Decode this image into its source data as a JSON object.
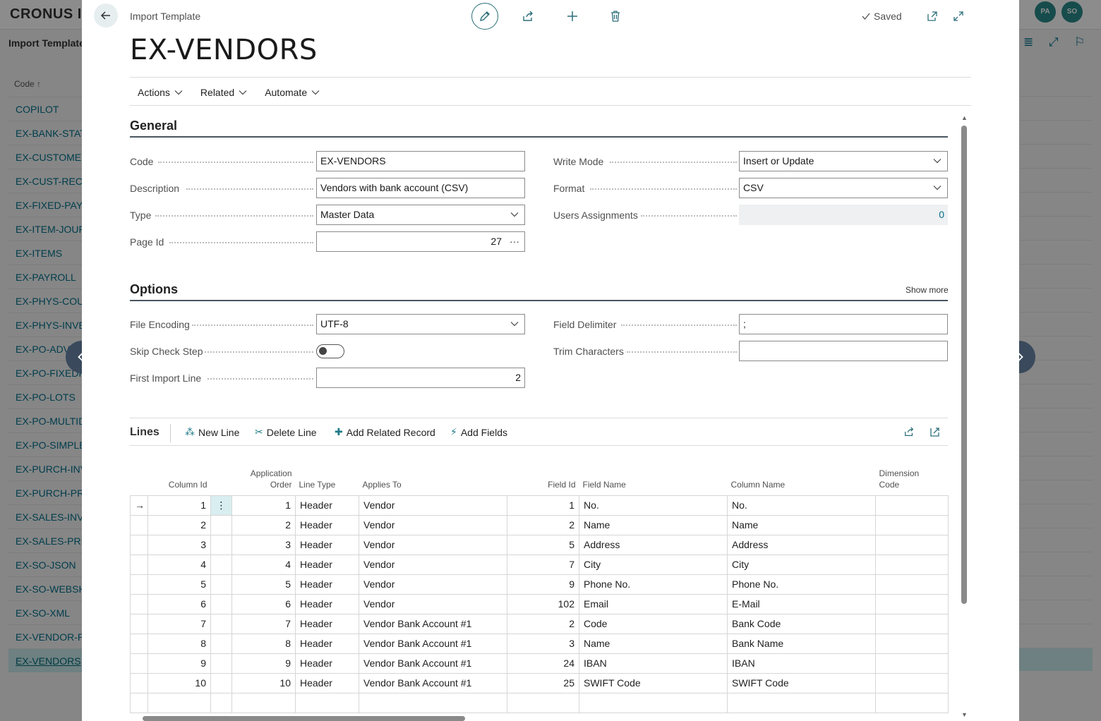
{
  "background": {
    "company": "CRONUS IT",
    "page_title": "Import Template",
    "column_header": "Code ↑",
    "avatars": [
      "PA",
      "SO"
    ],
    "list": [
      "COPILOT",
      "EX-BANK-STATE",
      "EX-CUSTOMERS",
      "EX-CUST-RECEI",
      "EX-FIXED-PAYR",
      "EX-ITEM-JOURN",
      "EX-ITEMS",
      "EX-PAYROLL",
      "EX-PHYS-COUN",
      "EX-PHYS-INVEN",
      "EX-PO-ADV",
      "EX-PO-FIXEDH",
      "EX-PO-LOTS",
      "EX-PO-MULTID",
      "EX-PO-SIMPLE",
      "EX-PURCH-INV",
      "EX-PURCH-PRIC",
      "EX-SALES-INVC",
      "EX-SALES-PRIC",
      "EX-SO-JSON",
      "EX-SO-WEBSHO",
      "EX-SO-XML",
      "EX-VENDOR-PA",
      "EX-VENDORS"
    ]
  },
  "dialog": {
    "caption": "Import Template",
    "title": "EX-VENDORS",
    "saved": "Saved",
    "menu": [
      "Actions",
      "Related",
      "Automate"
    ]
  },
  "general": {
    "title": "General",
    "code_label": "Code",
    "code": "EX-VENDORS",
    "description_label": "Description",
    "description": "Vendors with bank account (CSV)",
    "type_label": "Type",
    "type": "Master Data",
    "page_id_label": "Page Id",
    "page_id": "27",
    "write_mode_label": "Write Mode",
    "write_mode": "Insert or Update",
    "format_label": "Format",
    "format": "CSV",
    "users_assignments_label": "Users Assignments",
    "users_assignments": "0"
  },
  "options": {
    "title": "Options",
    "show_more": "Show more",
    "file_encoding_label": "File Encoding",
    "file_encoding": "UTF-8",
    "skip_check_step_label": "Skip Check Step",
    "skip_check_step": false,
    "first_import_line_label": "First Import Line",
    "first_import_line": "2",
    "field_delimiter_label": "Field Delimiter",
    "field_delimiter": ";",
    "trim_characters_label": "Trim Characters",
    "trim_characters": ""
  },
  "lines": {
    "title": "Lines",
    "actions": [
      "New Line",
      "Delete Line",
      "Add Related Record",
      "Add Fields"
    ],
    "headers": {
      "column_id": "Column Id",
      "application_order_1": "Application",
      "application_order_2": "Order",
      "line_type": "Line Type",
      "applies_to": "Applies To",
      "field_id": "Field Id",
      "field_name": "Field Name",
      "column_name": "Column Name",
      "dimension_code_1": "Dimension",
      "dimension_code_2": "Code"
    },
    "rows": [
      {
        "column_id": "1",
        "order": "1",
        "line_type": "Header",
        "applies_to": "Vendor",
        "field_id": "1",
        "field_name": "No.",
        "column_name": "No.",
        "dimension_code": ""
      },
      {
        "column_id": "2",
        "order": "2",
        "line_type": "Header",
        "applies_to": "Vendor",
        "field_id": "2",
        "field_name": "Name",
        "column_name": "Name",
        "dimension_code": ""
      },
      {
        "column_id": "3",
        "order": "3",
        "line_type": "Header",
        "applies_to": "Vendor",
        "field_id": "5",
        "field_name": "Address",
        "column_name": "Address",
        "dimension_code": ""
      },
      {
        "column_id": "4",
        "order": "4",
        "line_type": "Header",
        "applies_to": "Vendor",
        "field_id": "7",
        "field_name": "City",
        "column_name": "City",
        "dimension_code": ""
      },
      {
        "column_id": "5",
        "order": "5",
        "line_type": "Header",
        "applies_to": "Vendor",
        "field_id": "9",
        "field_name": "Phone No.",
        "column_name": "Phone No.",
        "dimension_code": ""
      },
      {
        "column_id": "6",
        "order": "6",
        "line_type": "Header",
        "applies_to": "Vendor",
        "field_id": "102",
        "field_name": "Email",
        "column_name": "E-Mail",
        "dimension_code": ""
      },
      {
        "column_id": "7",
        "order": "7",
        "line_type": "Header",
        "applies_to": "Vendor Bank Account #1",
        "field_id": "2",
        "field_name": "Code",
        "column_name": "Bank Code",
        "dimension_code": ""
      },
      {
        "column_id": "8",
        "order": "8",
        "line_type": "Header",
        "applies_to": "Vendor Bank Account #1",
        "field_id": "3",
        "field_name": "Name",
        "column_name": "Bank Name",
        "dimension_code": ""
      },
      {
        "column_id": "9",
        "order": "9",
        "line_type": "Header",
        "applies_to": "Vendor Bank Account #1",
        "field_id": "24",
        "field_name": "IBAN",
        "column_name": "IBAN",
        "dimension_code": ""
      },
      {
        "column_id": "10",
        "order": "10",
        "line_type": "Header",
        "applies_to": "Vendor Bank Account #1",
        "field_id": "25",
        "field_name": "SWIFT Code",
        "column_name": "SWIFT Code",
        "dimension_code": ""
      }
    ]
  }
}
